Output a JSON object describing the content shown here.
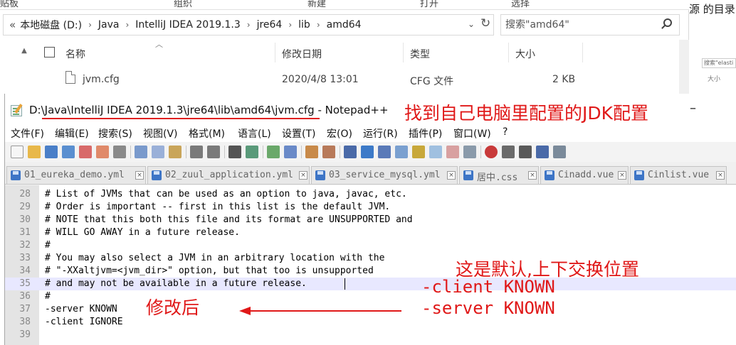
{
  "explorer": {
    "ribbon": [
      "组织",
      "新建",
      "打开",
      "选择"
    ],
    "ribbon_left": "贴板",
    "breadcrumb_prefix": "«",
    "breadcrumb": [
      "本地磁盘 (D:)",
      "Java",
      "IntelliJ IDEA 2019.1.3",
      "jre64",
      "lib",
      "amd64"
    ],
    "search_placeholder": "搜索\"amd64\"",
    "columns": {
      "name": "名称",
      "date": "修改日期",
      "type": "类型",
      "size": "大小"
    },
    "file": {
      "name": "jvm.cfg",
      "date": "2020/4/8 13:01",
      "type": "CFG 文件",
      "size": "2 KB"
    }
  },
  "right_window": {
    "text": "源 的目录",
    "search": "搜索\"elasti",
    "size": "大小"
  },
  "notepad": {
    "title": "D:\\Java\\IntelliJ IDEA 2019.1.3\\jre64\\lib\\amd64\\jvm.cfg - Notepad++",
    "minimize": "–",
    "menu": [
      "文件(F)",
      "编辑(E)",
      "搜索(S)",
      "视图(V)",
      "格式(M)",
      "语言(L)",
      "设置(T)",
      "宏(O)",
      "运行(R)",
      "插件(P)",
      "窗口(W)",
      "?"
    ],
    "tabs": [
      "01_eureka_demo.yml",
      "02_zuul_application.yml",
      "03_service_mysql.yml",
      "居中.css",
      "Cinadd.vue",
      "Cinlist.vue"
    ],
    "tab_close": "×",
    "lines": [
      {
        "n": "28",
        "text": "# List of JVMs that can be used as an option to java, javac, etc."
      },
      {
        "n": "29",
        "text": "# Order is important -- first in this list is the default JVM."
      },
      {
        "n": "30",
        "text": "# NOTE that this both this file and its format are UNSUPPORTED and"
      },
      {
        "n": "31",
        "text": "# WILL GO AWAY in a future release."
      },
      {
        "n": "32",
        "text": "#"
      },
      {
        "n": "33",
        "text": "# You may also select a JVM in an arbitrary location with the"
      },
      {
        "n": "34",
        "text": "# \"-XXaltjvm=<jvm_dir>\" option, but that too is unsupported"
      },
      {
        "n": "35",
        "text": "# and may not be available in a future release."
      },
      {
        "n": "36",
        "text": "#"
      },
      {
        "n": "37",
        "text": "-server KNOWN"
      },
      {
        "n": "38",
        "text": "-client IGNORE"
      },
      {
        "n": "39",
        "text": ""
      }
    ]
  },
  "annotations": {
    "top": "找到自己电脑里配置的JDK配置",
    "default_note": "这是默认,上下交换位置",
    "client_known": "-client KNOWN",
    "server_known": "-server KNOWN",
    "after": "修改后"
  },
  "colors": {
    "annotation": "#e01818",
    "current_line": "#e8e8ff",
    "gutter": "#e4e4e4",
    "disk_icon": "#3d75c6"
  }
}
